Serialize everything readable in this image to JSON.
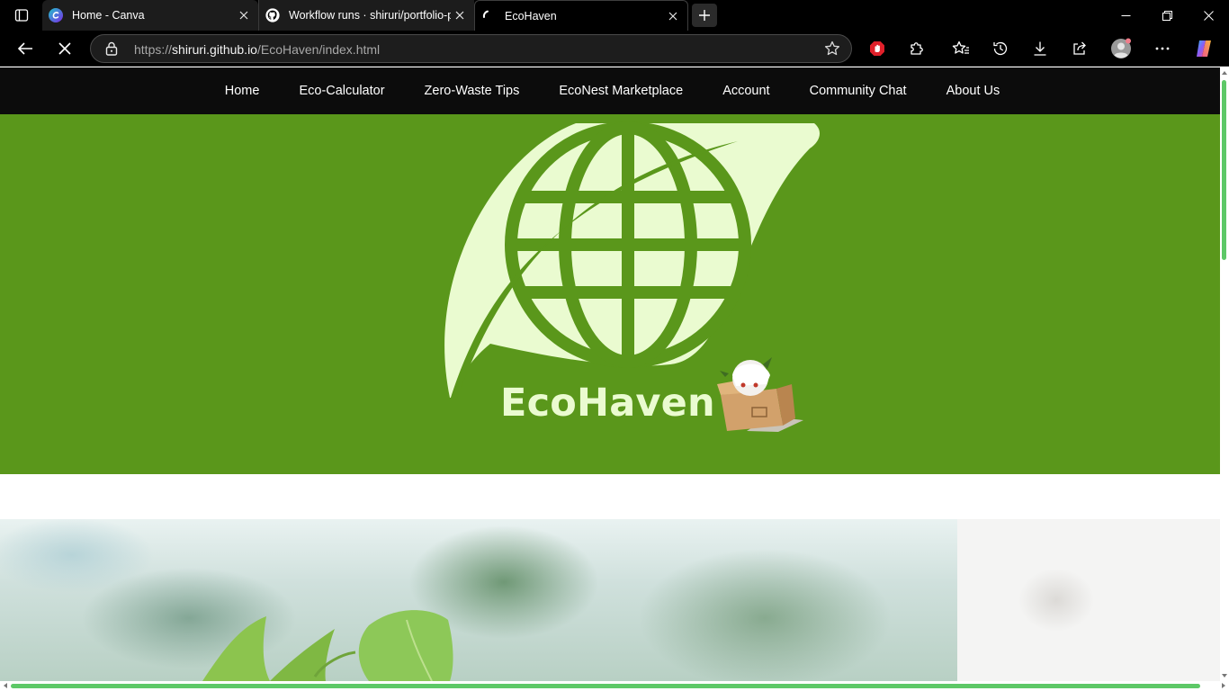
{
  "browser": {
    "tabs": [
      {
        "title": "Home - Canva",
        "favicon": "canva-icon",
        "active": false
      },
      {
        "title": "Workflow runs · shiruri/portfolio-p",
        "favicon": "github-icon",
        "active": false
      },
      {
        "title": "EcoHaven",
        "favicon": "loading-spinner-icon",
        "active": true
      }
    ],
    "new_tab_label": "+",
    "address": {
      "scheme": "https://",
      "host": "shiruri.github.io",
      "path": "/EcoHaven/index.html"
    },
    "toolbar_icons": [
      "back-icon",
      "stop-loading-icon",
      "lock-icon",
      "add-favorite-star-icon",
      "adblock-extension-icon",
      "extensions-icon",
      "favorites-icon",
      "history-icon",
      "downloads-icon",
      "share-icon",
      "profile-avatar-icon",
      "more-menu-icon",
      "copilot-icon"
    ],
    "window_controls": [
      "minimize-icon",
      "restore-icon",
      "close-icon"
    ]
  },
  "site": {
    "nav": [
      {
        "label": "Home"
      },
      {
        "label": "Eco-Calculator"
      },
      {
        "label": "Zero-Waste Tips"
      },
      {
        "label": "EcoNest Marketplace"
      },
      {
        "label": "Account"
      },
      {
        "label": "Community Chat"
      },
      {
        "label": "About Us"
      }
    ],
    "hero": {
      "brand": "EcoHaven",
      "logo": "leaf-globe-logo",
      "mascot": "chibi-character-in-cardboard-box"
    },
    "images": [
      "blurred-green-leaves-photo",
      "blurred-light-photo"
    ]
  },
  "colors": {
    "hero_bg": "#5a971b",
    "logo_fill": "#eafbd0",
    "nav_bg": "#0c0c0c",
    "scroll_thumb": "#5dc867"
  }
}
